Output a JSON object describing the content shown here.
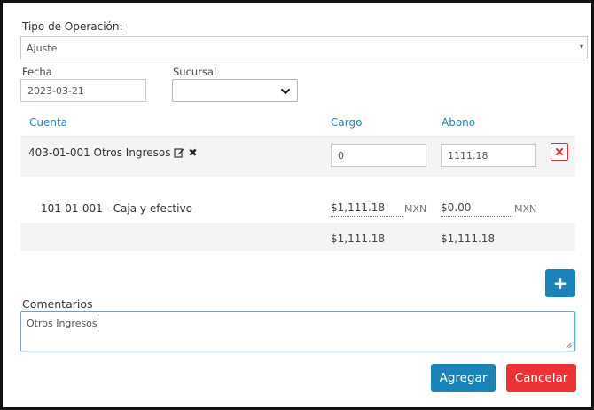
{
  "form": {
    "operation_type_label": "Tipo de Operación:",
    "operation_type_value": "Ajuste",
    "date_label": "Fecha",
    "date_value": "2023-03-21",
    "branch_label": "Sucursal",
    "branch_value": ""
  },
  "table": {
    "headers": {
      "account": "Cuenta",
      "charge": "Cargo",
      "credit": "Abono"
    },
    "entry": {
      "account": "403-01-001 Otros Ingresos",
      "charge": "0",
      "credit": "1111.18"
    },
    "counter_entry": {
      "account": "101-01-001 - Caja y efectivo",
      "charge": "$1,111.18",
      "charge_currency": "MXN",
      "credit": "$0.00",
      "credit_currency": "MXN"
    },
    "totals": {
      "charge": "$1,111.18",
      "credit": "$1,111.18"
    }
  },
  "comments": {
    "label": "Comentarios",
    "value": "Otros Ingresos"
  },
  "actions": {
    "add_row": "+",
    "submit": "Agregar",
    "cancel": "Cancelar"
  },
  "colors": {
    "accent": "#1a83b8",
    "danger": "#ec3232",
    "header_text": "#2a84b8"
  }
}
